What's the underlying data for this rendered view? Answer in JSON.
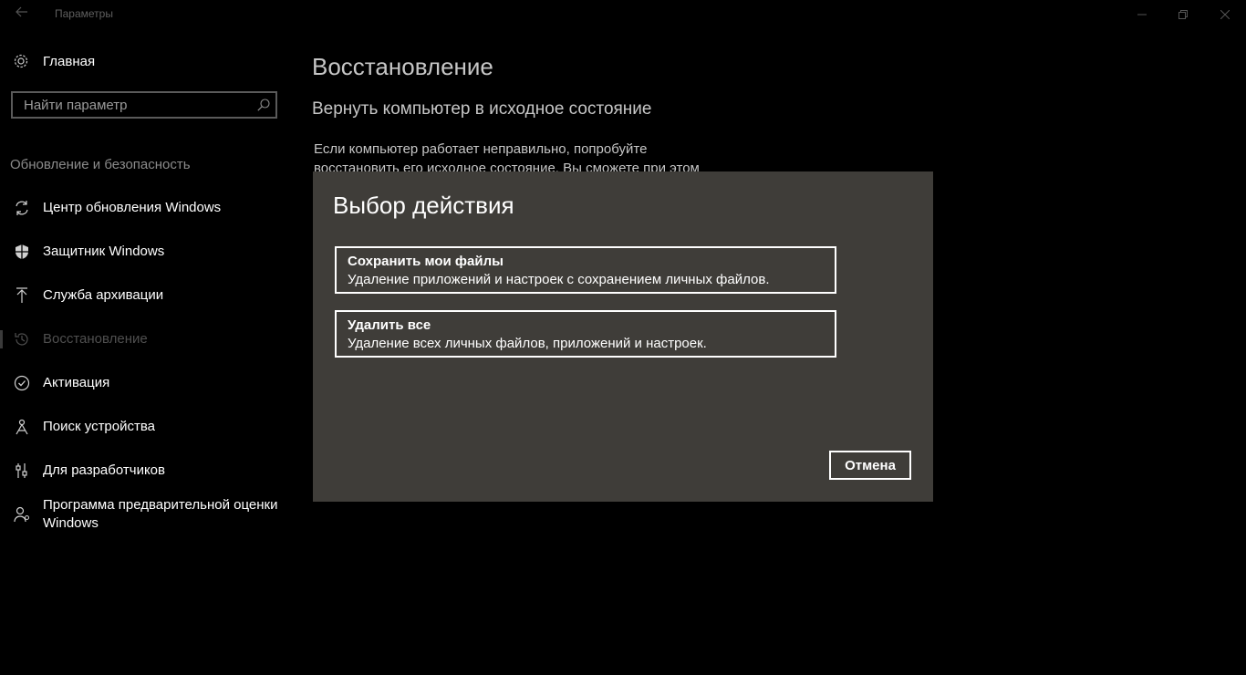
{
  "titlebar": {
    "title": "Параметры",
    "back_icon": "arrow-left-icon",
    "minimize_icon": "minimize-icon",
    "maximize_icon": "restore-icon",
    "close_icon": "close-icon"
  },
  "sidebar": {
    "home_label": "Главная",
    "search_placeholder": "Найти параметр",
    "section_title": "Обновление и безопасность",
    "items": [
      {
        "label": "Центр обновления Windows",
        "icon": "sync-icon",
        "active": false
      },
      {
        "label": "Защитник Windows",
        "icon": "shield-icon",
        "active": false
      },
      {
        "label": "Служба архивации",
        "icon": "backup-arrow-icon",
        "active": false
      },
      {
        "label": "Восстановление",
        "icon": "history-icon",
        "active": true
      },
      {
        "label": "Активация",
        "icon": "check-circle-icon",
        "active": false
      },
      {
        "label": "Поиск устройства",
        "icon": "find-device-icon",
        "active": false
      },
      {
        "label": "Для разработчиков",
        "icon": "developer-sliders-icon",
        "active": false
      },
      {
        "label": "Программа предварительной оценки Windows",
        "icon": "insider-person-icon",
        "active": false
      }
    ]
  },
  "main": {
    "title": "Восстановление",
    "subtitle": "Вернуть компьютер в исходное состояние",
    "description": "Если компьютер работает неправильно, попробуйте восстановить его исходное состояние. Вы сможете при этом"
  },
  "dialog": {
    "title": "Выбор действия",
    "options": [
      {
        "title": "Сохранить мои файлы",
        "description": "Удаление приложений и настроек с сохранением личных файлов."
      },
      {
        "title": "Удалить все",
        "description": "Удаление всех личных файлов, приложений и настроек."
      }
    ],
    "cancel_label": "Отмена"
  },
  "colors": {
    "background": "#000000",
    "dialog_background": "#3f3d39",
    "section_text": "#8b8b8b"
  }
}
